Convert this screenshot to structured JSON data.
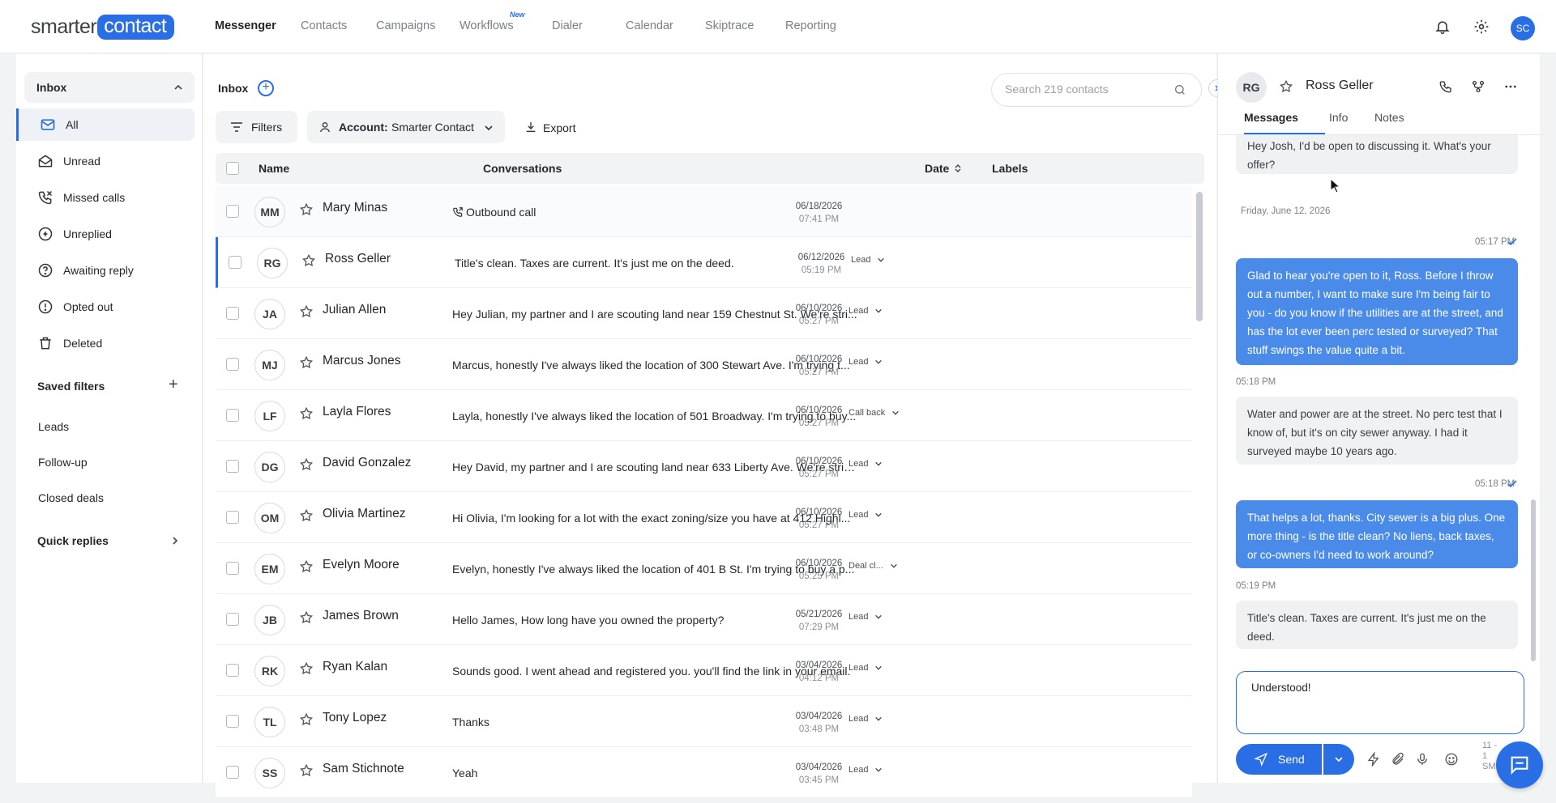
{
  "brand": {
    "part1": "smarter",
    "part2": "contact",
    "accent": "#2a6ee6"
  },
  "nav": {
    "items": [
      "Messenger",
      "Contacts",
      "Campaigns",
      "Workflows",
      "Dialer",
      "Calendar",
      "Skiptrace",
      "Reporting"
    ],
    "active": "Messenger",
    "new_badge": "New"
  },
  "user_initials": "SC",
  "sidebar": {
    "inbox_label": "Inbox",
    "items": [
      {
        "label": "All",
        "icon": "mail-icon"
      },
      {
        "label": "Unread",
        "icon": "mail-open-icon"
      },
      {
        "label": "Missed calls",
        "icon": "missed-call-icon"
      },
      {
        "label": "Unreplied",
        "icon": "reply-icon"
      },
      {
        "label": "Awaiting reply",
        "icon": "question-icon"
      },
      {
        "label": "Opted out",
        "icon": "alert-icon"
      },
      {
        "label": "Deleted",
        "icon": "trash-icon"
      }
    ],
    "saved_filters_title": "Saved filters",
    "saved_filters": [
      "Leads",
      "Follow-up",
      "Closed deals"
    ],
    "quick_replies": "Quick replies"
  },
  "main": {
    "title": "Inbox",
    "search_placeholder": "Search 219 contacts",
    "filters_label": "Filters",
    "account_label": "Account:",
    "account_value": "Smarter Contact",
    "export_label": "Export",
    "columns": {
      "name": "Name",
      "conversations": "Conversations",
      "date": "Date",
      "labels": "Labels"
    },
    "rows": [
      {
        "initials": "MM",
        "name": "Mary Minas",
        "conv": "Outbound call",
        "call": true,
        "date": "06/18/2026",
        "time": "07:41 PM",
        "label": ""
      },
      {
        "initials": "RG",
        "name": "Ross Geller",
        "conv": "Title's clean. Taxes are current. It's just me on the deed.",
        "date": "06/12/2026",
        "time": "05:19 PM",
        "label": "Lead",
        "selected": true
      },
      {
        "initials": "JA",
        "name": "Julian Allen",
        "conv": "Hey Julian, my partner and I are scouting land near 159 Chestnut St. We're stri...",
        "date": "06/10/2026",
        "time": "05:27 PM",
        "label": "Lead"
      },
      {
        "initials": "MJ",
        "name": "Marcus Jones",
        "conv": "Marcus, honestly I've always liked the location of 300 Stewart Ave. I'm trying t...",
        "date": "06/10/2026",
        "time": "05:27 PM",
        "label": "Lead"
      },
      {
        "initials": "LF",
        "name": "Layla Flores",
        "conv": "Layla, honestly I've always liked the location of 501 Broadway. I'm trying to buy...",
        "date": "06/10/2026",
        "time": "05:27 PM",
        "label": "Call back"
      },
      {
        "initials": "DG",
        "name": "David Gonzalez",
        "conv": "Hey David, my partner and I are scouting land near 633 Liberty Ave. We're stric...",
        "date": "06/10/2026",
        "time": "05:27 PM",
        "label": "Lead"
      },
      {
        "initials": "OM",
        "name": "Olivia Martinez",
        "conv": "Hi Olivia, I'm looking for a lot with the exact zoning/size you have at 412 Highl...",
        "date": "06/10/2026",
        "time": "05:27 PM",
        "label": "Lead"
      },
      {
        "initials": "EM",
        "name": "Evelyn Moore",
        "conv": "Evelyn, honestly I've always liked the location of 401 B St. I'm trying to buy a p...",
        "date": "06/10/2026",
        "time": "05:25 PM",
        "label": "Deal cl..."
      },
      {
        "initials": "JB",
        "name": "James Brown",
        "conv": "Hello James, How long have you owned the property?",
        "date": "05/21/2026",
        "time": "07:29 PM",
        "label": "Lead"
      },
      {
        "initials": "RK",
        "name": "Ryan Kalan",
        "conv": "Sounds good. I went ahead and registered you. you'll find the link in your email.",
        "date": "03/04/2026",
        "time": "04:12 PM",
        "label": "Lead"
      },
      {
        "initials": "TL",
        "name": "Tony Lopez",
        "conv": "Thanks",
        "date": "03/04/2026",
        "time": "03:48 PM",
        "label": "Lead"
      },
      {
        "initials": "SS",
        "name": "Sam Stichnote",
        "conv": "Yeah",
        "date": "03/04/2026",
        "time": "03:45 PM",
        "label": "Lead"
      }
    ]
  },
  "panel": {
    "initials": "RG",
    "name": "Ross Geller",
    "tabs": [
      "Messages",
      "Info",
      "Notes"
    ],
    "messages": {
      "m0": "Hey Josh, I'd be open to discussing it. What's your offer?",
      "date_sep": "Friday, June 12, 2026",
      "t1": "05:17 PM",
      "m1": "Glad to hear you're open to it, Ross. Before I throw out a number, I want to make sure I'm being fair to you - do you know if the utilities are at the street, and has the lot ever been perc tested or surveyed? That stuff swings the value quite a bit.",
      "t2": "05:18 PM",
      "m2": "Water and power are at the street. No perc test that I know of, but it's on city sewer anyway. I had it surveyed maybe 10 years ago.",
      "t3": "05:18 PM",
      "m3": "That helps a lot, thanks. City sewer is a big plus. One more thing - is the title clean? No liens, back taxes, or co-owners I'd need to work around?",
      "t4": "05:19 PM",
      "m4": "Title's clean. Taxes are current. It's just me on the deed."
    },
    "draft": "Understood!",
    "send_label": "Send",
    "counter": "11 -\n1\nSM"
  }
}
